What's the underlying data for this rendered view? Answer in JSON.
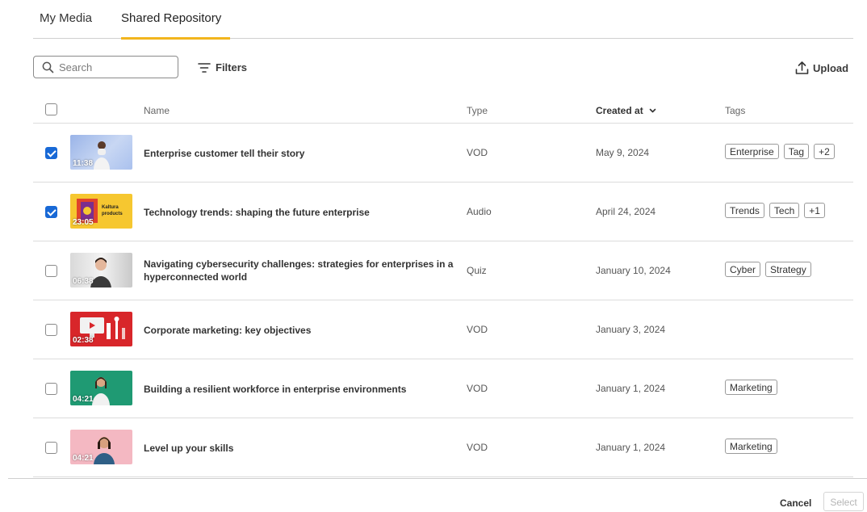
{
  "tabs": [
    {
      "label": "My Media",
      "active": false
    },
    {
      "label": "Shared Repository",
      "active": true
    }
  ],
  "accent_color": "#f2b51d",
  "toolbar": {
    "search_placeholder": "Search",
    "search_icon": "search-icon",
    "filters_label": "Filters",
    "filters_icon": "filter-icon",
    "upload_label": "Upload",
    "upload_icon": "upload-icon"
  },
  "table": {
    "columns": {
      "name": "Name",
      "type": "Type",
      "created": "Created at",
      "tags": "Tags"
    },
    "sort_icon": "chevron-down-icon",
    "rows": [
      {
        "checked": true,
        "duration": "11:38",
        "name": "Enterprise customer tell their story",
        "type": "VOD",
        "date": "May 9, 2024",
        "tags": [
          "Enterprise",
          "Tag",
          "+2"
        ]
      },
      {
        "checked": true,
        "duration": "23:05",
        "thumb_text": "Kaltura products",
        "name": "Technology trends: shaping the future enterprise",
        "type": "Audio",
        "date": "April 24, 2024",
        "tags": [
          "Trends",
          "Tech",
          "+1"
        ]
      },
      {
        "checked": false,
        "duration": "06:38",
        "name": "Navigating cybersecurity challenges: strategies for enterprises in a hyperconnected world",
        "type": "Quiz",
        "date": "January 10, 2024",
        "tags": [
          "Cyber",
          "Strategy"
        ]
      },
      {
        "checked": false,
        "duration": "02:38",
        "name": "Corporate marketing: key objectives",
        "type": "VOD",
        "date": "January 3, 2024",
        "tags": []
      },
      {
        "checked": false,
        "duration": "04:21",
        "name": "Building a resilient workforce in enterprise environments",
        "type": "VOD",
        "date": "January 1, 2024",
        "tags": [
          "Marketing"
        ]
      },
      {
        "checked": false,
        "duration": "04:21",
        "name": "Level up your skills",
        "type": "VOD",
        "date": "January 1, 2024",
        "tags": [
          "Marketing"
        ]
      }
    ]
  },
  "footer": {
    "cancel_label": "Cancel",
    "select_label": "Select"
  }
}
